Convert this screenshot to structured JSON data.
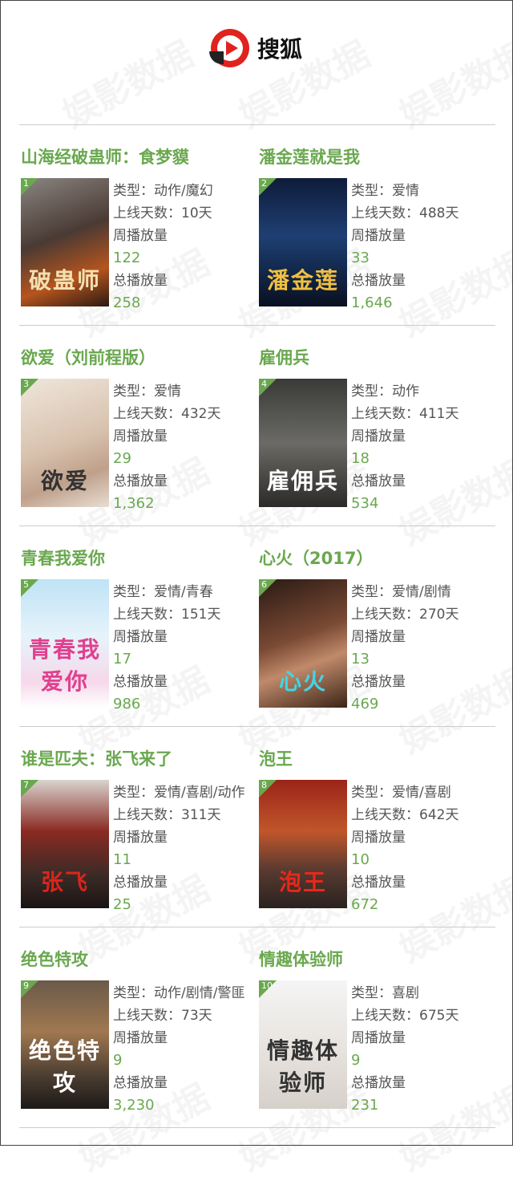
{
  "header": {
    "brand": "搜狐",
    "logo_icon": "sohu-video-logo-icon"
  },
  "watermark_text": "娱影数据",
  "labels": {
    "type_prefix": "类型：",
    "days_prefix": "上线天数：",
    "weekly_label": "周播放量",
    "total_label": "总播放量"
  },
  "accent_color": "#6aa84f",
  "items": [
    {
      "rank": "1",
      "title": "山海经破蛊师：食梦貘",
      "type": "动作/魔幻",
      "days": "10天",
      "weekly": "122",
      "total": "258",
      "poster_text": "破蛊师",
      "poster_bg": "linear-gradient(160deg,#8a8580,#4a3a34 45%,#b5541e 75%,#2a1a12)",
      "poster_fg": "#f2e0b0"
    },
    {
      "rank": "2",
      "title": "潘金莲就是我",
      "type": "爱情",
      "days": "488天",
      "weekly": "33",
      "total": "1,646",
      "poster_text": "潘金莲",
      "poster_bg": "linear-gradient(180deg,#0e1c3a,#1f3f73 45%,#132a4f 70%,#0a1020)",
      "poster_fg": "#f0c040"
    },
    {
      "rank": "3",
      "title": "欲爱（刘前程版）",
      "type": "爱情",
      "days": "432天",
      "weekly": "29",
      "total": "1,362",
      "poster_text": "欲爱",
      "poster_bg": "linear-gradient(160deg,#efe6dc,#d8c2ae 50%,#bfa08a 75%,#e8ddd2)",
      "poster_fg": "#333333"
    },
    {
      "rank": "4",
      "title": "雇佣兵",
      "type": "动作",
      "days": "411天",
      "weekly": "18",
      "total": "534",
      "poster_text": "雇佣兵",
      "poster_bg": "linear-gradient(180deg,#3a3a38,#6b6a66 50%,#2b2a28)",
      "poster_fg": "#ffffff"
    },
    {
      "rank": "5",
      "title": "青春我爱你",
      "type": "爱情/青春",
      "days": "151天",
      "weekly": "17",
      "total": "986",
      "poster_text": "青春我爱你",
      "poster_bg": "linear-gradient(180deg,#bfe3f5,#e6f3fb 45%,#f6d8ea 80%,#ffffff)",
      "poster_fg": "#e0408f"
    },
    {
      "rank": "6",
      "title": "心火（2017）",
      "type": "爱情/剧情",
      "days": "270天",
      "weekly": "13",
      "total": "469",
      "poster_text": "心火",
      "poster_bg": "linear-gradient(160deg,#2a1a14,#7a4a34 45%,#c08a6a 65%,#3a2418)",
      "poster_fg": "#3fd6e8"
    },
    {
      "rank": "7",
      "title": "谁是匹夫：张飞来了",
      "type": "爱情/喜剧/动作",
      "days": "311天",
      "weekly": "11",
      "total": "25",
      "poster_text": "张飞",
      "poster_bg": "linear-gradient(180deg,#d8d4ce,#8a2a22 40%,#3a2a26 75%,#1a1414)",
      "poster_fg": "#d8261c"
    },
    {
      "rank": "8",
      "title": "泡王",
      "type": "爱情/喜剧",
      "days": "642天",
      "weekly": "10",
      "total": "672",
      "poster_text": "泡王",
      "poster_bg": "linear-gradient(180deg,#9a2418,#c0562a 40%,#5a3a30 70%,#2a2220)",
      "poster_fg": "#e8281a"
    },
    {
      "rank": "9",
      "title": "绝色特攻",
      "type": "动作/剧情/警匪",
      "days": "73天",
      "weekly": "9",
      "total": "3,230",
      "poster_text": "绝色特攻",
      "poster_bg": "linear-gradient(180deg,#6a5a4a,#a07850 40%,#4a3c30 75%,#1c1a18)",
      "poster_fg": "#ffffff"
    },
    {
      "rank": "10",
      "title": "情趣体验师",
      "type": "喜剧",
      "days": "675天",
      "weekly": "9",
      "total": "231",
      "poster_text": "情趣体验师",
      "poster_bg": "linear-gradient(180deg,#f5f5f5,#e8e4e0 50%,#d6d0ca)",
      "poster_fg": "#333333"
    }
  ]
}
